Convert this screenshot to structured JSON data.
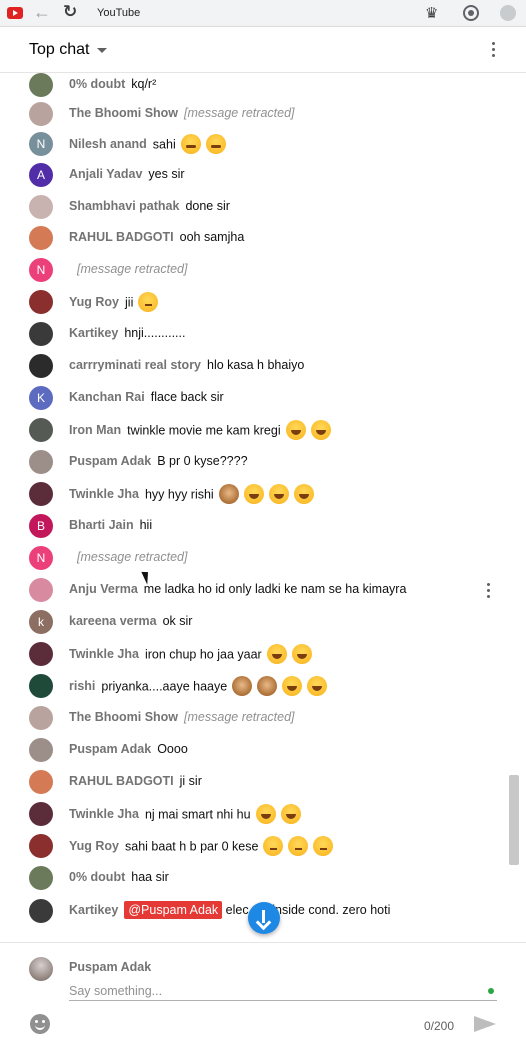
{
  "browser": {
    "tab_title": "YouTube",
    "favicon": "youtube-icon",
    "icons": [
      "back-icon",
      "reload-icon",
      "extensions-icon",
      "pin-icon",
      "profile-icon"
    ]
  },
  "chat": {
    "title": "Top chat",
    "retracted_label": "[message retracted]"
  },
  "messages": [
    {
      "author": "0% doubt",
      "text": "kq/r²",
      "avatar_color": "#6b7a5a",
      "emojis": []
    },
    {
      "author": "The Bhoomi Show",
      "text": "",
      "retracted": true,
      "avatar_color": "#b9a39e",
      "emojis": []
    },
    {
      "author": "Nilesh anand",
      "text": "sahi",
      "avatar_letter": "N",
      "avatar_color": "#78909c",
      "emojis": [
        "hug",
        "hug"
      ]
    },
    {
      "author": "Anjali Yadav",
      "text": "yes sir",
      "avatar_letter": "A",
      "avatar_color": "#512da8",
      "emojis": []
    },
    {
      "author": "Shambhavi pathak",
      "text": "done sir",
      "avatar_color": "#c9b3b0",
      "emojis": []
    },
    {
      "author": "RAHUL BADGOTI",
      "text": "ooh samjha",
      "avatar_color": "#d47a55",
      "emojis": []
    },
    {
      "author": "",
      "text": "",
      "retracted": true,
      "avatar_letter": "N",
      "avatar_color": "#ec407a",
      "emojis": []
    },
    {
      "author": "Yug Roy",
      "text": "jii",
      "avatar_color": "#8a2e2e",
      "emojis": [
        "think"
      ]
    },
    {
      "author": "Kartikey",
      "text": "hnji............",
      "avatar_color": "#3a3a3a",
      "emojis": []
    },
    {
      "author": "carrryminati real story",
      "text": "hlo kasa h bhaiyo",
      "avatar_color": "#2b2b2b",
      "emojis": []
    },
    {
      "author": "Kanchan Rai",
      "text": "flace back sir",
      "avatar_letter": "K",
      "avatar_color": "#5c6bc0",
      "emojis": []
    },
    {
      "author": "Iron Man",
      "text": "twinkle movie me kam kregi",
      "avatar_color": "#555a55",
      "emojis": [
        "laugh",
        "laugh"
      ]
    },
    {
      "author": "Puspam Adak",
      "text": "B pr 0 kyse????",
      "avatar_color": "#9c8f8a",
      "emojis": []
    },
    {
      "author": "Twinkle Jha",
      "text": "hyy hyy rishi",
      "avatar_color": "#5b2d3a",
      "emojis": [
        "monkey",
        "laugh",
        "laugh",
        "laugh"
      ]
    },
    {
      "author": "Bharti Jain",
      "text": "hii",
      "avatar_letter": "B",
      "avatar_color": "#c2185b",
      "emojis": []
    },
    {
      "author": "",
      "text": "",
      "retracted": true,
      "avatar_letter": "N",
      "avatar_color": "#ec407a",
      "emojis": []
    },
    {
      "author": "Anju Verma",
      "text": "me ladka ho id only ladki ke nam se ha kimayra",
      "avatar_color": "#d88aa0",
      "emojis": [],
      "hovered": true
    },
    {
      "author": "kareena verma",
      "text": "ok sir",
      "avatar_letter": "k",
      "avatar_color": "#8d6e63",
      "emojis": []
    },
    {
      "author": "Twinkle Jha",
      "text": "iron chup ho jaa yaar",
      "avatar_color": "#5b2d3a",
      "emojis": [
        "laugh",
        "laugh"
      ]
    },
    {
      "author": "rishi",
      "text": "priyanka....aaye haaye",
      "avatar_color": "#1f4a3a",
      "emojis": [
        "monkey",
        "monkey",
        "laugh",
        "laugh"
      ]
    },
    {
      "author": "The Bhoomi Show",
      "text": "",
      "retracted": true,
      "avatar_color": "#b9a39e",
      "emojis": []
    },
    {
      "author": "Puspam Adak",
      "text": "Oooo",
      "avatar_color": "#9c8f8a",
      "emojis": []
    },
    {
      "author": "RAHUL BADGOTI",
      "text": "ji sir",
      "avatar_color": "#d47a55",
      "emojis": []
    },
    {
      "author": "Twinkle Jha",
      "text": "nj mai smart nhi hu",
      "avatar_color": "#5b2d3a",
      "emojis": [
        "laugh",
        "laugh"
      ]
    },
    {
      "author": "Yug Roy",
      "text": "sahi baat h b par 0 kese",
      "avatar_color": "#8a2e2e",
      "emojis": [
        "think",
        "think",
        "think"
      ]
    },
    {
      "author": "0% doubt",
      "text": "haa sir",
      "avatar_color": "#6b7a5a",
      "emojis": []
    },
    {
      "author": "Kartikey",
      "mention": "@Puspam Adak",
      "text": "elec      eld inside cond. zero hoti",
      "avatar_color": "#3a3a3a",
      "emojis": []
    }
  ],
  "input": {
    "author": "Puspam Adak",
    "placeholder": "Say something...",
    "char_count": "0/200"
  }
}
